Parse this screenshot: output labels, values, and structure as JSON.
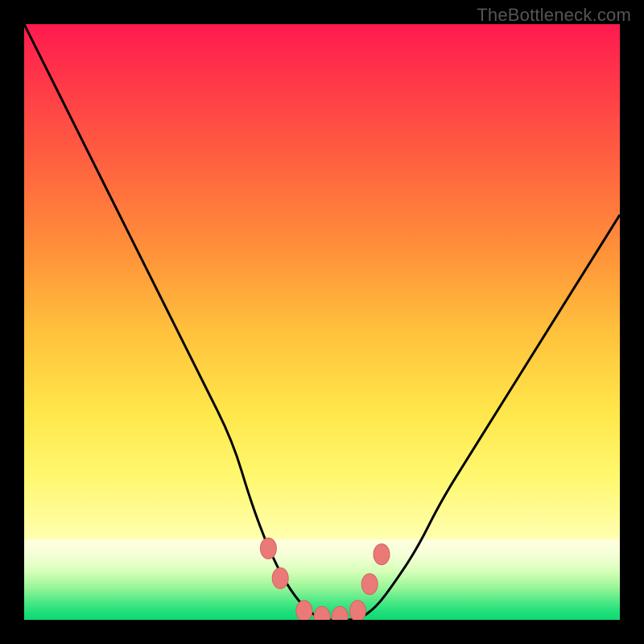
{
  "attribution": "TheBottleneck.com",
  "colors": {
    "page_bg": "#000000",
    "grad_top_stops": [
      "#ff1a4f",
      "#ff3a48",
      "#ff6a3e",
      "#ff943a",
      "#ffc23c",
      "#ffe64a",
      "#fff86f",
      "#ffffb0"
    ],
    "grad_bottom_stops": [
      "#ffffe0",
      "#f4ffd6",
      "#d6ffb8",
      "#98f598",
      "#4be885",
      "#1fe07a",
      "#10d874"
    ],
    "curve_stroke": "#000000",
    "marker_fill": "#e97a78",
    "marker_stroke": "#d46360"
  },
  "chart_data": {
    "type": "line",
    "title": "",
    "xlabel": "",
    "ylabel": "",
    "ylim": [
      0,
      100
    ],
    "xlim": [
      0,
      100
    ],
    "x": [
      0,
      5,
      10,
      15,
      20,
      25,
      30,
      35,
      38,
      41,
      44,
      47,
      50,
      53,
      56,
      59,
      62,
      66,
      70,
      75,
      80,
      85,
      90,
      95,
      100
    ],
    "values": [
      100,
      90,
      80,
      70,
      60,
      50,
      40,
      30,
      20,
      12,
      6,
      2,
      0,
      0,
      0,
      2,
      6,
      12,
      20,
      28,
      36,
      44,
      52,
      60,
      68
    ],
    "markers": [
      {
        "x": 41,
        "y": 12
      },
      {
        "x": 43,
        "y": 7
      },
      {
        "x": 47,
        "y": 1.5
      },
      {
        "x": 50,
        "y": 0.5
      },
      {
        "x": 53,
        "y": 0.5
      },
      {
        "x": 56,
        "y": 1.5
      },
      {
        "x": 58,
        "y": 6
      },
      {
        "x": 60,
        "y": 11
      }
    ],
    "grid": false,
    "legend": false,
    "annotation": "TheBottleneck.com"
  }
}
